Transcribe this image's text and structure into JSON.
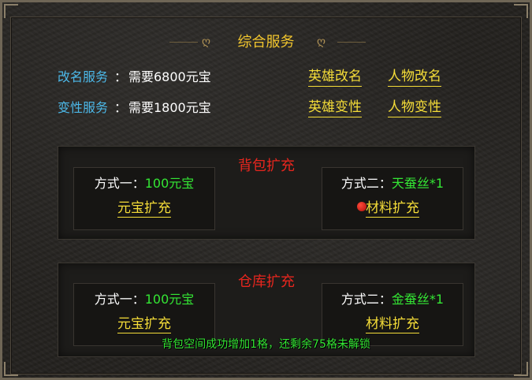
{
  "panel_title": "综合服务",
  "rename": {
    "label": "改名服务",
    "colon": "：",
    "cost": "需要6800元宝",
    "hero_link": "英雄改名",
    "char_link": "人物改名"
  },
  "gender": {
    "label": "变性服务",
    "colon": "：",
    "cost": "需要1800元宝",
    "hero_link": "英雄变性",
    "char_link": "人物变性"
  },
  "bag": {
    "title": "背包扩充",
    "method1": {
      "label": "方式一：",
      "cost": "100元宝",
      "action": "元宝扩充"
    },
    "method2": {
      "label": "方式二：",
      "cost": "天蚕丝*1",
      "action": "材料扩充"
    }
  },
  "warehouse": {
    "title": "仓库扩充",
    "method1": {
      "label": "方式一：",
      "cost": "100元宝",
      "action": "元宝扩充"
    },
    "method2": {
      "label": "方式二：",
      "cost": "金蚕丝*1",
      "action": "材料扩充"
    }
  },
  "notification": "背包空间成功增加1格，还剩余75格未解锁",
  "colors": {
    "title": "#f2c62e",
    "service_label": "#4cb8e8",
    "link": "#f4dc38",
    "section_title": "#e8261e",
    "cost": "#34e634"
  },
  "icons": {
    "title_ornament": "scroll-ornament-icon",
    "red_dot": "notification-dot-icon"
  }
}
